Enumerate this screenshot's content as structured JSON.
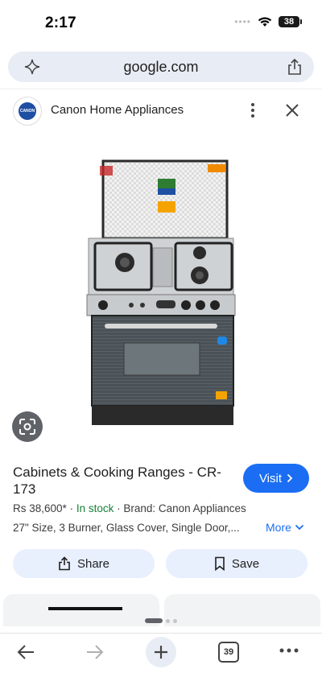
{
  "status": {
    "time": "2:17",
    "battery": "38"
  },
  "urlbar": {
    "url": "google.com"
  },
  "source": {
    "name": "Canon Home Appliances",
    "logo_text": "CANON"
  },
  "product": {
    "title": "Cabinets & Cooking Ranges - CR-173",
    "price": "Rs 38,600*",
    "stock": "In stock",
    "brand": "Brand: Canon Appliances",
    "description": "27\" Size, 3 Burner, Glass Cover, Single Door,...",
    "more_label": "More"
  },
  "actions": {
    "visit": "Visit",
    "share": "Share",
    "save": "Save"
  },
  "nav": {
    "tab_count": "39"
  },
  "colors": {
    "accent": "#1b6ef3",
    "stock": "#188038",
    "pill": "#e8effd"
  },
  "icons": [
    "sparkle-icon",
    "share-icon",
    "more-vert-icon",
    "close-icon",
    "google-lens-icon",
    "chevron-right-icon",
    "chevron-down-icon",
    "bookmark-icon",
    "back-arrow-icon",
    "forward-arrow-icon",
    "plus-icon",
    "tabs-icon",
    "more-horiz-icon"
  ]
}
